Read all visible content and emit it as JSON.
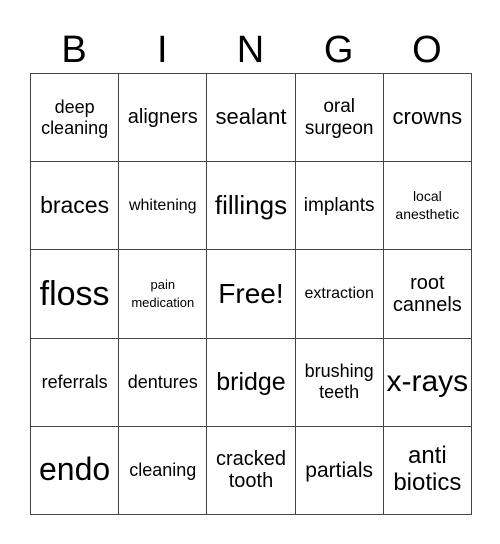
{
  "header": [
    "B",
    "I",
    "N",
    "G",
    "O"
  ],
  "rows": [
    [
      {
        "text": "deep cleaning",
        "size": 18
      },
      {
        "text": "aligners",
        "size": 20
      },
      {
        "text": "sealant",
        "size": 22
      },
      {
        "text": "oral surgeon",
        "size": 19
      },
      {
        "text": "crowns",
        "size": 22
      }
    ],
    [
      {
        "text": "braces",
        "size": 23
      },
      {
        "text": "whitening",
        "size": 16
      },
      {
        "text": "fillings",
        "size": 26
      },
      {
        "text": "implants",
        "size": 19
      },
      {
        "text": "local anesthetic",
        "size": 14
      }
    ],
    [
      {
        "text": "floss",
        "size": 34
      },
      {
        "text": "pain medication",
        "size": 13
      },
      {
        "text": "Free!",
        "size": 28
      },
      {
        "text": "extraction",
        "size": 16
      },
      {
        "text": "root cannels",
        "size": 20
      }
    ],
    [
      {
        "text": "referrals",
        "size": 18
      },
      {
        "text": "dentures",
        "size": 18
      },
      {
        "text": "bridge",
        "size": 25
      },
      {
        "text": "brushing teeth",
        "size": 18
      },
      {
        "text": "x-rays",
        "size": 30
      }
    ],
    [
      {
        "text": "endo",
        "size": 32
      },
      {
        "text": "cleaning",
        "size": 18
      },
      {
        "text": "cracked tooth",
        "size": 20
      },
      {
        "text": "partials",
        "size": 21
      },
      {
        "text": "anti biotics",
        "size": 24
      }
    ]
  ]
}
